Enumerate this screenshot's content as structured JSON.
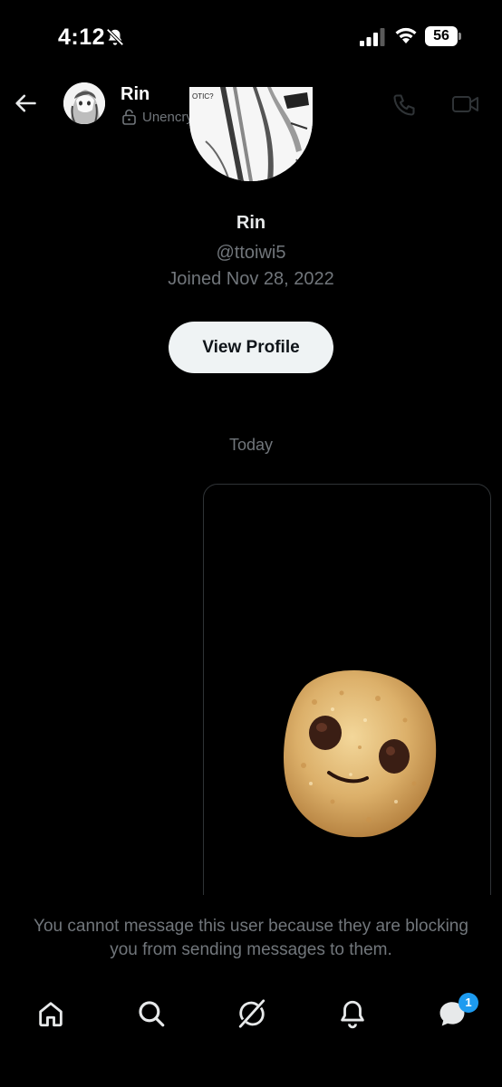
{
  "status_bar": {
    "time": "4:12",
    "battery": "56"
  },
  "header": {
    "name": "Rin",
    "encryption": "Unencrypted"
  },
  "profile": {
    "name": "Rin",
    "handle": "@ttoiwi5",
    "joined": "Joined Nov 28, 2022",
    "view_profile_label": "View Profile",
    "avatar_text": "OTIC?"
  },
  "conversation": {
    "date_divider": "Today",
    "message_media": "cookie-image"
  },
  "blocked_notice": "You cannot message this user because they are blocking you from sending messages to them.",
  "tab_bar": {
    "items": [
      "home-icon",
      "search-icon",
      "grok-icon",
      "notifications-icon",
      "messages-icon"
    ],
    "messages_badge": "1"
  },
  "colors": {
    "background": "#000000",
    "primary_text": "#e7e9ea",
    "secondary_text": "#71767b",
    "accent": "#1d9bf0",
    "button_bg": "#eff3f4"
  }
}
